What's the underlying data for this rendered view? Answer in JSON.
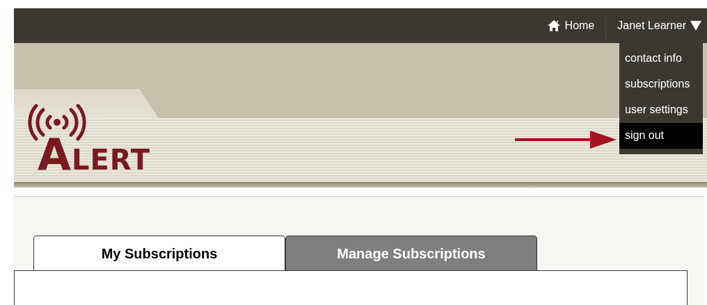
{
  "top_bar": {
    "home": "Home",
    "user": "Janet Learner"
  },
  "user_menu": [
    {
      "label": "contact info",
      "selected": false
    },
    {
      "label": "subscriptions",
      "selected": false
    },
    {
      "label": "user settings",
      "selected": false
    },
    {
      "label": "sign out",
      "selected": true
    }
  ],
  "logo": {
    "text": "ALERT"
  },
  "tabs": [
    {
      "label": "My Subscriptions",
      "selected": true
    },
    {
      "label": "Manage Subscriptions",
      "selected": false
    }
  ]
}
